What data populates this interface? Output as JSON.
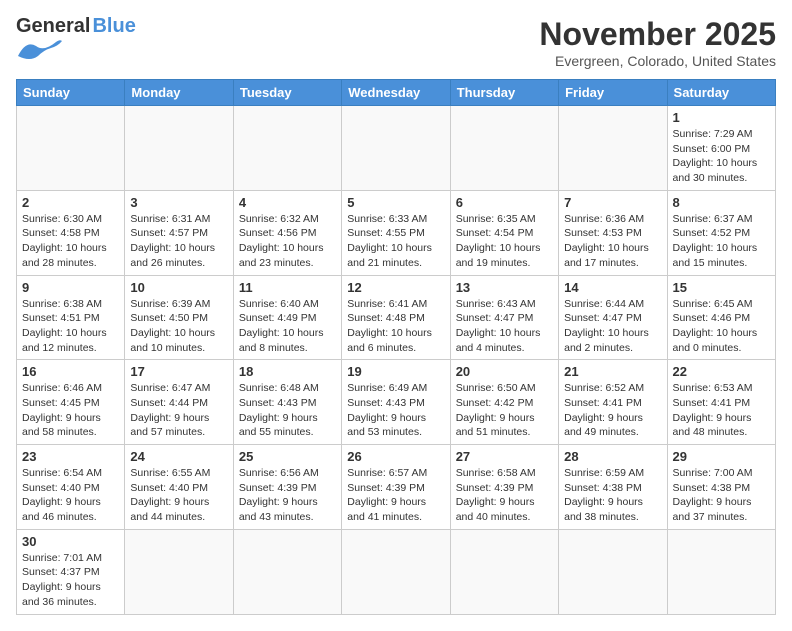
{
  "header": {
    "logo_general": "General",
    "logo_blue": "Blue",
    "title": "November 2025",
    "subtitle": "Evergreen, Colorado, United States"
  },
  "weekdays": [
    "Sunday",
    "Monday",
    "Tuesday",
    "Wednesday",
    "Thursday",
    "Friday",
    "Saturday"
  ],
  "weeks": [
    [
      {
        "day": "",
        "info": ""
      },
      {
        "day": "",
        "info": ""
      },
      {
        "day": "",
        "info": ""
      },
      {
        "day": "",
        "info": ""
      },
      {
        "day": "",
        "info": ""
      },
      {
        "day": "",
        "info": ""
      },
      {
        "day": "1",
        "info": "Sunrise: 7:29 AM\nSunset: 6:00 PM\nDaylight: 10 hours\nand 30 minutes."
      }
    ],
    [
      {
        "day": "2",
        "info": "Sunrise: 6:30 AM\nSunset: 4:58 PM\nDaylight: 10 hours\nand 28 minutes."
      },
      {
        "day": "3",
        "info": "Sunrise: 6:31 AM\nSunset: 4:57 PM\nDaylight: 10 hours\nand 26 minutes."
      },
      {
        "day": "4",
        "info": "Sunrise: 6:32 AM\nSunset: 4:56 PM\nDaylight: 10 hours\nand 23 minutes."
      },
      {
        "day": "5",
        "info": "Sunrise: 6:33 AM\nSunset: 4:55 PM\nDaylight: 10 hours\nand 21 minutes."
      },
      {
        "day": "6",
        "info": "Sunrise: 6:35 AM\nSunset: 4:54 PM\nDaylight: 10 hours\nand 19 minutes."
      },
      {
        "day": "7",
        "info": "Sunrise: 6:36 AM\nSunset: 4:53 PM\nDaylight: 10 hours\nand 17 minutes."
      },
      {
        "day": "8",
        "info": "Sunrise: 6:37 AM\nSunset: 4:52 PM\nDaylight: 10 hours\nand 15 minutes."
      }
    ],
    [
      {
        "day": "9",
        "info": "Sunrise: 6:38 AM\nSunset: 4:51 PM\nDaylight: 10 hours\nand 12 minutes."
      },
      {
        "day": "10",
        "info": "Sunrise: 6:39 AM\nSunset: 4:50 PM\nDaylight: 10 hours\nand 10 minutes."
      },
      {
        "day": "11",
        "info": "Sunrise: 6:40 AM\nSunset: 4:49 PM\nDaylight: 10 hours\nand 8 minutes."
      },
      {
        "day": "12",
        "info": "Sunrise: 6:41 AM\nSunset: 4:48 PM\nDaylight: 10 hours\nand 6 minutes."
      },
      {
        "day": "13",
        "info": "Sunrise: 6:43 AM\nSunset: 4:47 PM\nDaylight: 10 hours\nand 4 minutes."
      },
      {
        "day": "14",
        "info": "Sunrise: 6:44 AM\nSunset: 4:47 PM\nDaylight: 10 hours\nand 2 minutes."
      },
      {
        "day": "15",
        "info": "Sunrise: 6:45 AM\nSunset: 4:46 PM\nDaylight: 10 hours\nand 0 minutes."
      }
    ],
    [
      {
        "day": "16",
        "info": "Sunrise: 6:46 AM\nSunset: 4:45 PM\nDaylight: 9 hours\nand 58 minutes."
      },
      {
        "day": "17",
        "info": "Sunrise: 6:47 AM\nSunset: 4:44 PM\nDaylight: 9 hours\nand 57 minutes."
      },
      {
        "day": "18",
        "info": "Sunrise: 6:48 AM\nSunset: 4:43 PM\nDaylight: 9 hours\nand 55 minutes."
      },
      {
        "day": "19",
        "info": "Sunrise: 6:49 AM\nSunset: 4:43 PM\nDaylight: 9 hours\nand 53 minutes."
      },
      {
        "day": "20",
        "info": "Sunrise: 6:50 AM\nSunset: 4:42 PM\nDaylight: 9 hours\nand 51 minutes."
      },
      {
        "day": "21",
        "info": "Sunrise: 6:52 AM\nSunset: 4:41 PM\nDaylight: 9 hours\nand 49 minutes."
      },
      {
        "day": "22",
        "info": "Sunrise: 6:53 AM\nSunset: 4:41 PM\nDaylight: 9 hours\nand 48 minutes."
      }
    ],
    [
      {
        "day": "23",
        "info": "Sunrise: 6:54 AM\nSunset: 4:40 PM\nDaylight: 9 hours\nand 46 minutes."
      },
      {
        "day": "24",
        "info": "Sunrise: 6:55 AM\nSunset: 4:40 PM\nDaylight: 9 hours\nand 44 minutes."
      },
      {
        "day": "25",
        "info": "Sunrise: 6:56 AM\nSunset: 4:39 PM\nDaylight: 9 hours\nand 43 minutes."
      },
      {
        "day": "26",
        "info": "Sunrise: 6:57 AM\nSunset: 4:39 PM\nDaylight: 9 hours\nand 41 minutes."
      },
      {
        "day": "27",
        "info": "Sunrise: 6:58 AM\nSunset: 4:39 PM\nDaylight: 9 hours\nand 40 minutes."
      },
      {
        "day": "28",
        "info": "Sunrise: 6:59 AM\nSunset: 4:38 PM\nDaylight: 9 hours\nand 38 minutes."
      },
      {
        "day": "29",
        "info": "Sunrise: 7:00 AM\nSunset: 4:38 PM\nDaylight: 9 hours\nand 37 minutes."
      }
    ],
    [
      {
        "day": "30",
        "info": "Sunrise: 7:01 AM\nSunset: 4:37 PM\nDaylight: 9 hours\nand 36 minutes."
      },
      {
        "day": "",
        "info": ""
      },
      {
        "day": "",
        "info": ""
      },
      {
        "day": "",
        "info": ""
      },
      {
        "day": "",
        "info": ""
      },
      {
        "day": "",
        "info": ""
      },
      {
        "day": "",
        "info": ""
      }
    ]
  ]
}
